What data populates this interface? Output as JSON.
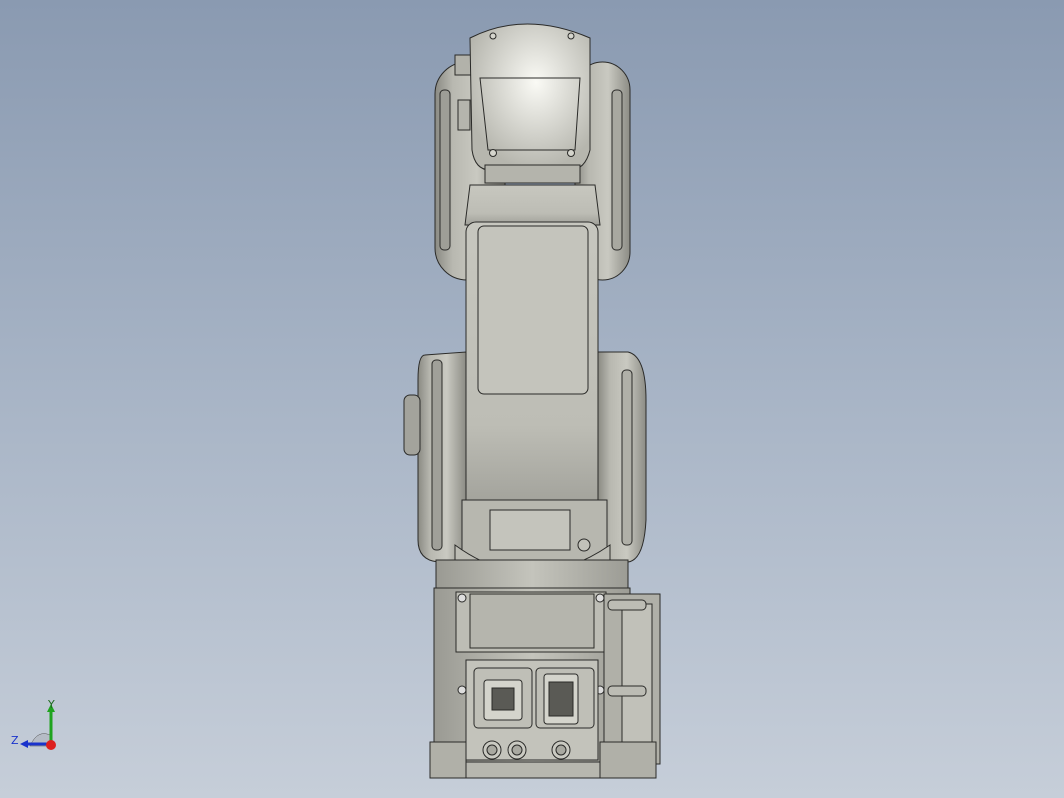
{
  "viewport": {
    "background_top": "#8a9ab1",
    "background_bottom": "#c6ced9",
    "model_color": "#c8c8c0",
    "edge_color": "#2a2a28"
  },
  "triad": {
    "y_label": "Y",
    "z_label": "Z",
    "y_color": "#1fa31f",
    "z_color": "#1a33cc",
    "x_color": "#dd1f1f"
  }
}
